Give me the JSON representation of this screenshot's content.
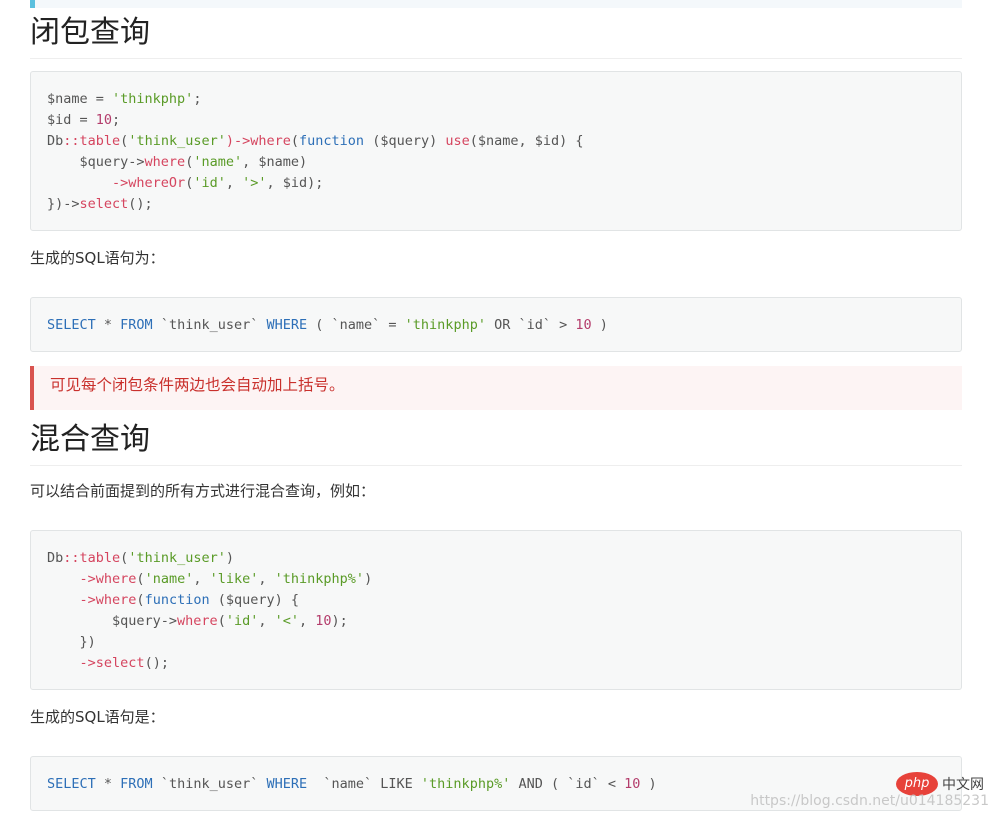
{
  "section1": {
    "title": "闭包查询",
    "code": {
      "l1_a": "$name",
      "l1_b": " = ",
      "l1_c": "'thinkphp'",
      "l1_d": ";",
      "l2_a": "$id",
      "l2_b": " = ",
      "l2_c": "10",
      "l2_d": ";",
      "l3_a": "Db",
      "l3_b": "::",
      "l3_c": "table",
      "l3_d": "(",
      "l3_e": "'think_user'",
      "l3_f": ")->",
      "l3_g": "where",
      "l3_h": "(",
      "l3_i": "function",
      "l3_j": " ($query) ",
      "l3_k": "use",
      "l3_l": "($name, $id) {",
      "l4_a": "    $query->",
      "l4_b": "where",
      "l4_c": "(",
      "l4_d": "'name'",
      "l4_e": ", $name)",
      "l5_a": "        ->",
      "l5_b": "whereOr",
      "l5_c": "(",
      "l5_d": "'id'",
      "l5_e": ", ",
      "l5_f": "'>'",
      "l5_g": ", $id);",
      "l6_a": "})->",
      "l6_b": "select",
      "l6_c": "();"
    },
    "sql_intro": "生成的SQL语句为：",
    "sql": {
      "a": "SELECT",
      "b": " * ",
      "c": "FROM",
      "d": " `think_user` ",
      "e": "WHERE",
      "f": " ( `name` = ",
      "g": "'thinkphp'",
      "h": " OR `id` > ",
      "i": "10",
      "j": " )"
    },
    "note": "可见每个闭包条件两边也会自动加上括号。"
  },
  "section2": {
    "title": "混合查询",
    "intro": "可以结合前面提到的所有方式进行混合查询，例如：",
    "code": {
      "l1_a": "Db",
      "l1_b": "::",
      "l1_c": "table",
      "l1_d": "(",
      "l1_e": "'think_user'",
      "l1_f": ")",
      "l2_a": "    ->",
      "l2_b": "where",
      "l2_c": "(",
      "l2_d": "'name'",
      "l2_e": ", ",
      "l2_f": "'like'",
      "l2_g": ", ",
      "l2_h": "'thinkphp%'",
      "l2_i": ")",
      "l3_a": "    ->",
      "l3_b": "where",
      "l3_c": "(",
      "l3_d": "function",
      "l3_e": " ($query) {",
      "l4_a": "        $query->",
      "l4_b": "where",
      "l4_c": "(",
      "l4_d": "'id'",
      "l4_e": ", ",
      "l4_f": "'<'",
      "l4_g": ", ",
      "l4_h": "10",
      "l4_i": ");",
      "l5_a": "    })",
      "l6_a": "    ->",
      "l6_b": "select",
      "l6_c": "();"
    },
    "sql_intro": "生成的SQL语句是：",
    "sql": {
      "a": "SELECT",
      "b": " * ",
      "c": "FROM",
      "d": " `think_user` ",
      "e": "WHERE",
      "f": "  `name` ",
      "g": "LIKE ",
      "h": "'thinkphp%'",
      "i": " AND ( `id` < ",
      "j": "10",
      "k": " )"
    }
  },
  "watermark": {
    "logo": "php",
    "cn": "中文网",
    "url": "https://blog.csdn.net/u014185231"
  }
}
